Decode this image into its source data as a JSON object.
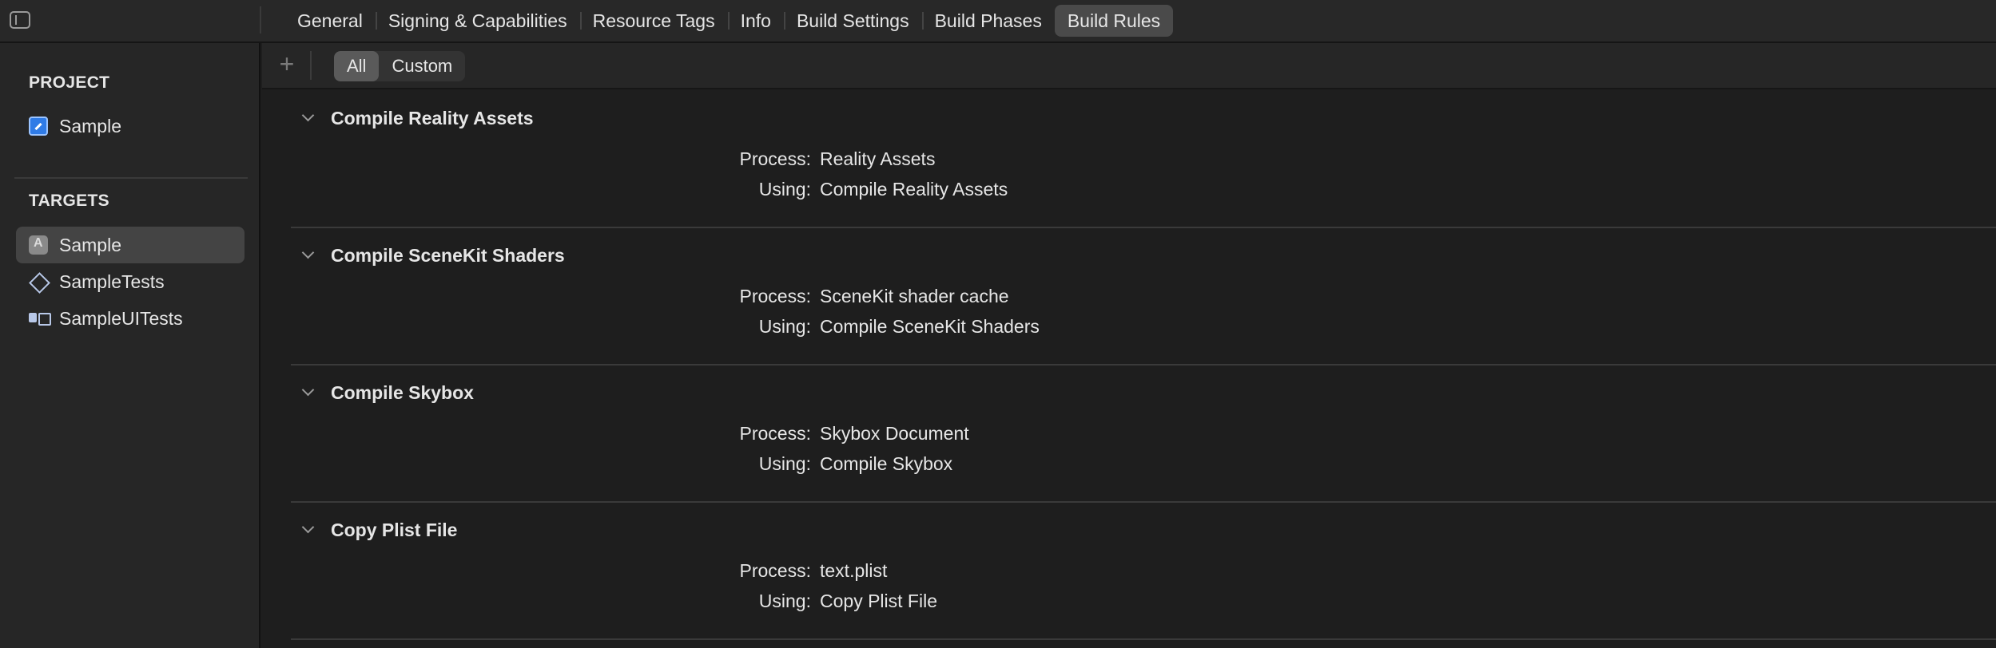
{
  "tabs": [
    "General",
    "Signing & Capabilities",
    "Resource Tags",
    "Info",
    "Build Settings",
    "Build Phases",
    "Build Rules"
  ],
  "active_tab": "Build Rules",
  "sidebar": {
    "project_header": "PROJECT",
    "project_item": "Sample",
    "targets_header": "TARGETS",
    "targets": [
      "Sample",
      "SampleTests",
      "SampleUITests"
    ]
  },
  "filter": {
    "add_label": "+",
    "segments": [
      "All",
      "Custom"
    ],
    "active_segment": "All"
  },
  "rules": [
    {
      "title": "Compile Reality Assets",
      "process_label": "Process:",
      "process": "Reality Assets",
      "using_label": "Using:",
      "using": "Compile Reality Assets"
    },
    {
      "title": "Compile SceneKit Shaders",
      "process_label": "Process:",
      "process": "SceneKit shader cache",
      "using_label": "Using:",
      "using": "Compile SceneKit Shaders"
    },
    {
      "title": "Compile Skybox",
      "process_label": "Process:",
      "process": "Skybox Document",
      "using_label": "Using:",
      "using": "Compile Skybox"
    },
    {
      "title": "Copy Plist File",
      "process_label": "Process:",
      "process": "text.plist",
      "using_label": "Using:",
      "using": "Copy Plist File"
    }
  ]
}
